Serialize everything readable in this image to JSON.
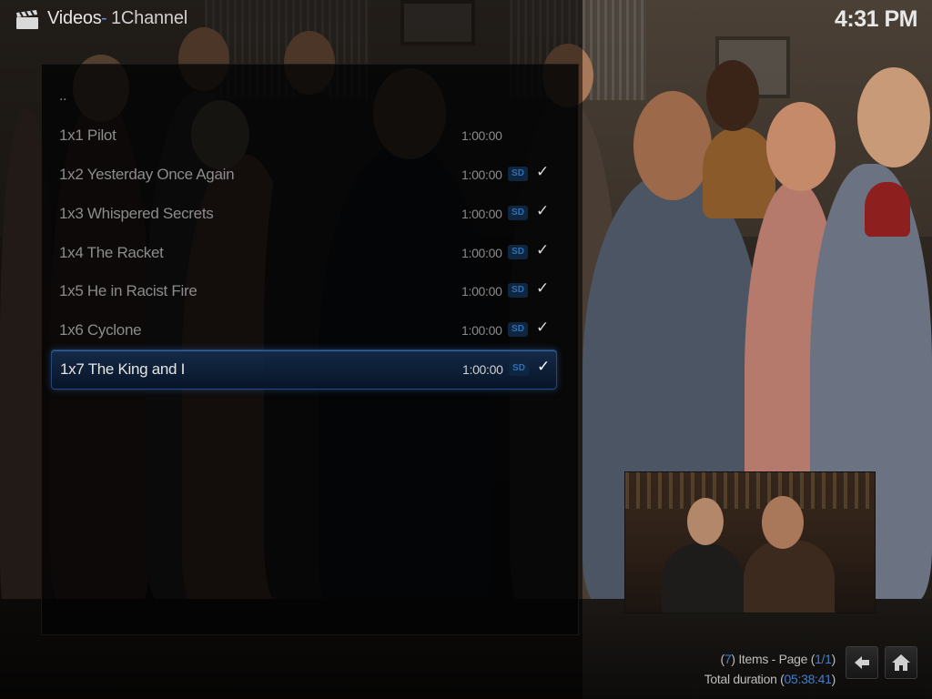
{
  "header": {
    "section": "Videos",
    "separator": "-",
    "subsection": "1Channel",
    "time": "4:31 PM"
  },
  "episodes": {
    "parent_label": "..",
    "items": [
      {
        "label": "1x1 Pilot",
        "duration": "1:00:00",
        "badge": "",
        "watched": false
      },
      {
        "label": "1x2 Yesterday Once Again",
        "duration": "1:00:00",
        "badge": "SD",
        "watched": true
      },
      {
        "label": "1x3 Whispered Secrets",
        "duration": "1:00:00",
        "badge": "SD",
        "watched": true
      },
      {
        "label": "1x4 The Racket",
        "duration": "1:00:00",
        "badge": "SD",
        "watched": true
      },
      {
        "label": "1x5 He in Racist Fire",
        "duration": "1:00:00",
        "badge": "SD",
        "watched": true
      },
      {
        "label": "1x6 Cyclone",
        "duration": "1:00:00",
        "badge": "SD",
        "watched": true
      },
      {
        "label": "1x7 The King and I",
        "duration": "1:00:00",
        "badge": "SD",
        "watched": true,
        "selected": true
      }
    ],
    "check_glyph": "✓"
  },
  "footer": {
    "items_count": "7",
    "items_label": "Items - Page",
    "page": "1/1",
    "duration_label": "Total duration",
    "total_duration": "05:38:41",
    "back_icon": "back-arrow-icon",
    "home_icon": "home-icon"
  },
  "colors": {
    "accent": "#3f7fd0",
    "selection": "#163052",
    "badge_bg": "#0f2640"
  }
}
